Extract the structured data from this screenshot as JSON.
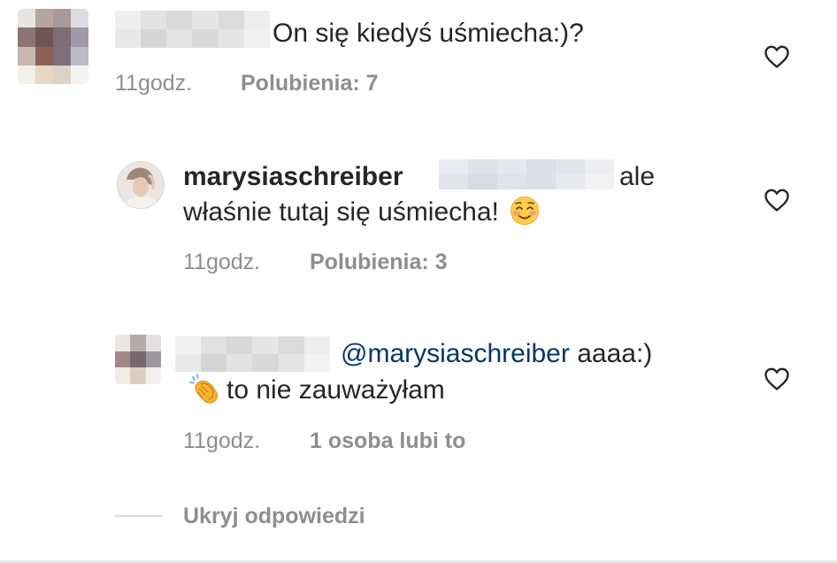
{
  "comments": [
    {
      "text": "On się kiedyś uśmiecha:)?",
      "time": "11godz.",
      "likes": "Polubienia: 7"
    },
    {
      "username": "marysiaschreiber",
      "text_line1": "ale",
      "text_line2": "właśnie tutaj się uśmiecha!",
      "emoji": "☺️",
      "time": "11godz.",
      "likes": "Polubienia: 3"
    },
    {
      "mention": "@marysiaschreiber",
      "text_line1": "aaaa:)",
      "emoji": "👏",
      "text_line2": "to nie zauważyłam",
      "time": "11godz.",
      "likes": "1 osoba lubi to"
    }
  ],
  "hide_replies_label": "Ukryj odpowiedzi",
  "icons": {
    "like": "heart-outline-icon"
  },
  "colors": {
    "text": "#262626",
    "meta": "#8e8e8e",
    "mention": "#00376b",
    "divider": "#dbdbdb"
  }
}
